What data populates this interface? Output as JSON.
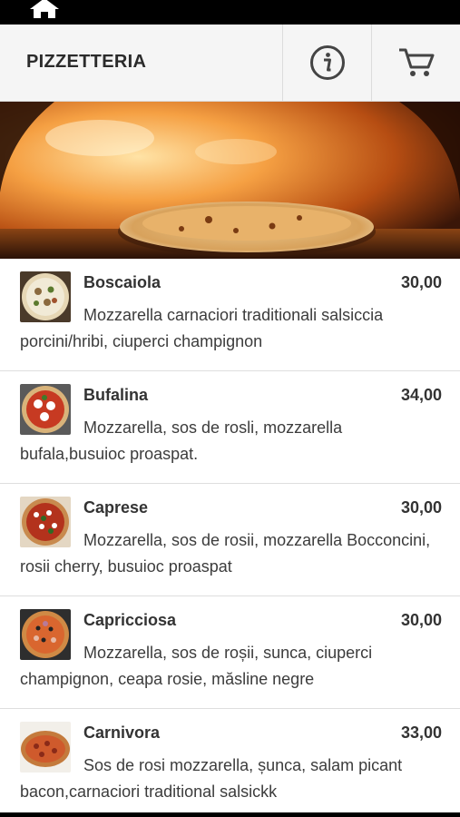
{
  "status_bar": {
    "home_icon": "home-icon"
  },
  "header": {
    "title": "PIZZETTERIA",
    "info_icon": "info-circle-icon",
    "cart_icon": "shopping-cart-icon"
  },
  "hero": {
    "image": "pizza-in-wood-oven"
  },
  "menu": {
    "items": [
      {
        "name": "Boscaiola",
        "price": "30,00",
        "description": "Mozzarella carnaciori traditionali salsiccia porcini/hribi, ciuperci champignon"
      },
      {
        "name": "Bufalina",
        "price": "34,00",
        "description": "Mozzarella, sos de rosli, mozzarella bufala,busuioc proaspat."
      },
      {
        "name": "Caprese",
        "price": "30,00",
        "description": "Mozzarella, sos de rosii, mozzarella Bocconcini, rosii cherry, busuioc proaspat"
      },
      {
        "name": "Capricciosa",
        "price": "30,00",
        "description": "Mozzarella, sos de roșii, sunca, ciuperci champignon, ceapa rosie, măsline negre"
      },
      {
        "name": "Carnivora",
        "price": "33,00",
        "description": "Sos de rosi mozzarella, șunca, salam picant bacon,carnaciori traditional salsickk"
      }
    ]
  },
  "colors": {
    "header_bg": "#f5f5f5",
    "text": "#333333",
    "divider": "#dedede"
  }
}
